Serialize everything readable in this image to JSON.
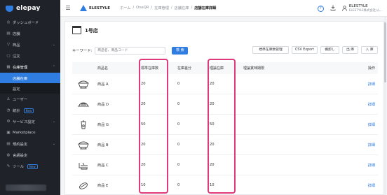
{
  "app": {
    "logo_text": "elepay"
  },
  "sidebar": {
    "items": [
      {
        "label": "ダッシュボード",
        "icon": "dashboard-icon",
        "chev": ""
      },
      {
        "label": "店舗",
        "icon": "store-icon",
        "chev": ""
      },
      {
        "label": "商品",
        "icon": "product-icon",
        "chev": "⌄"
      },
      {
        "label": "注文",
        "icon": "order-icon",
        "chev": ""
      },
      {
        "label": "在庫管理",
        "icon": "inventory-icon",
        "chev": "⌃"
      }
    ],
    "sub_items": [
      {
        "label": "店舗在庫",
        "active": true
      },
      {
        "label": "設定",
        "active": false
      }
    ],
    "items_after": [
      {
        "label": "ユーザー",
        "icon": "user-icon",
        "chev": "",
        "badge": ""
      },
      {
        "label": "統計",
        "icon": "stats-icon",
        "chev": "",
        "badge": "New"
      },
      {
        "label": "サービス設定",
        "icon": "service-settings-icon",
        "chev": "⌄",
        "badge": ""
      },
      {
        "label": "Marketplace",
        "icon": "marketplace-icon",
        "chev": "",
        "badge": ""
      },
      {
        "label": "規約設定",
        "icon": "terms-icon",
        "chev": "⌄",
        "badge": ""
      },
      {
        "label": "言語設定",
        "icon": "language-icon",
        "chev": "",
        "badge": ""
      },
      {
        "label": "ツール",
        "icon": "tool-icon",
        "chev": "",
        "badge": "New"
      }
    ]
  },
  "header": {
    "brand": "ELESTYLE",
    "breadcrumb": [
      "ホーム",
      "/",
      "OneQR",
      "/",
      "在庫管理",
      "/",
      "店舗在庫",
      "/"
    ],
    "breadcrumb_current": "店舗在庫詳細",
    "help_glyph": "?",
    "user_name": "ELESTYLE",
    "user_company": "ELESTYLE株式会社(ん..."
  },
  "store": {
    "name": "1号店"
  },
  "toolbar": {
    "keyword_label": "キーワード:",
    "keyword_placeholder": "商品名、商品コード",
    "search_label": "検 索",
    "buttons": [
      "標準在庫数管理",
      "CSV Export",
      "棚卸し",
      "出 庫",
      "入 庫"
    ]
  },
  "table": {
    "headers": [
      "",
      "商品名",
      "標準在庫数",
      "在庫差分",
      "理論在庫",
      "理論賞味期限",
      "操作"
    ],
    "rows": [
      {
        "icon": "bowl-icon",
        "name": "商品 A",
        "std": "20",
        "diff": "0",
        "theo": "20",
        "exp": "",
        "op": "詳細"
      },
      {
        "icon": "dish-icon",
        "name": "商品 D",
        "std": "20",
        "diff": "0",
        "theo": "20",
        "exp": "",
        "op": "詳細"
      },
      {
        "icon": "drink-icon",
        "name": "商品 G",
        "std": "50",
        "diff": "0",
        "theo": "50",
        "exp": "",
        "op": "詳細"
      },
      {
        "icon": "bowl-icon",
        "name": "商品 B",
        "std": "20",
        "diff": "0",
        "theo": "20",
        "exp": "",
        "op": "詳細"
      },
      {
        "icon": "grill-icon",
        "name": "商品 C",
        "std": "20",
        "diff": "0",
        "theo": "20",
        "exp": "",
        "op": "詳細"
      },
      {
        "icon": "sushi-icon",
        "name": "商品 E",
        "std": "10",
        "diff": "0",
        "theo": "10",
        "exp": "",
        "op": "詳細"
      }
    ]
  },
  "colors": {
    "accent": "#2f7de1",
    "highlight": "#e03a7a",
    "sidebar_bg": "#1f2329"
  }
}
